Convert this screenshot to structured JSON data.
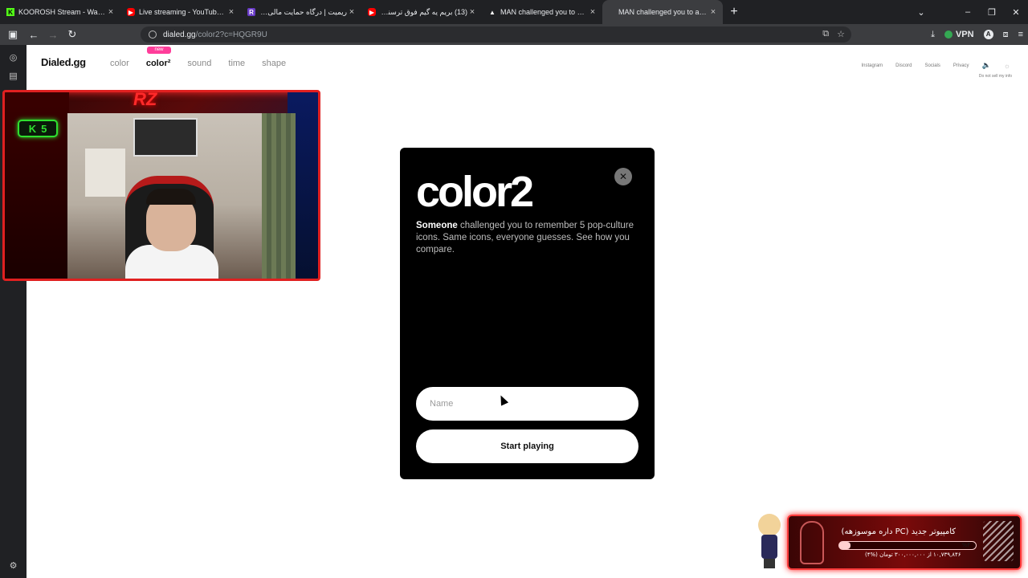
{
  "browser": {
    "tabs": [
      {
        "icon": "kick-icon",
        "title": "KOOROSH Stream - Watch Live",
        "active": false
      },
      {
        "icon": "youtube-icon",
        "title": "Live streaming - YouTube Studio",
        "active": false
      },
      {
        "icon": "reymit-icon",
        "title": "ریمیت | درگاه حمایت مالی از lad",
        "active": false
      },
      {
        "icon": "youtube-icon",
        "title": "(13) بریم یه گیم فوق ترسناک - e",
        "active": false
      },
      {
        "icon": "dialed-icon",
        "title": "MAN challenged you to a chara",
        "active": false
      },
      {
        "icon": "dialed-icon",
        "title": "MAN challenged you to a chara",
        "active": true
      }
    ],
    "url_host": "dialed.gg",
    "url_path": "/color2?c=HQGR9U",
    "vpn_label": "VPN",
    "profile_initial": "A"
  },
  "site": {
    "logo": "Dialed.gg",
    "nav": [
      {
        "label": "color",
        "active": false
      },
      {
        "label": "color²",
        "active": true
      },
      {
        "label": "sound",
        "active": false
      },
      {
        "label": "time",
        "active": false
      },
      {
        "label": "shape",
        "active": false
      }
    ],
    "new_badge": "new",
    "top_links": [
      "Instagram",
      "Discord",
      "Socials",
      "Privacy"
    ],
    "do_not_sell": "Do not sell my info"
  },
  "modal": {
    "title": "color2",
    "challenger": "Someone",
    "description": " challenged you to remember 5 pop-culture icons. Same icons, everyone guesses. See how you compare.",
    "name_placeholder": "Name",
    "start_label": "Start playing",
    "close_symbol": "✕"
  },
  "overlay": {
    "webcam_brand": "RZ",
    "kick_letter": "K",
    "kick_count": "5",
    "donation_title": "کامپیوتر جدید (PC داره موسوزهه)",
    "donation_percent_label": "%۴",
    "donation_progress": 0.04,
    "donation_amount": "۱۰,۷۳۹,۸۴۶ از ۳۰۰,۰۰۰,۰۰۰ تومان (%۴)"
  },
  "colors": {
    "modal_bg": "#000000",
    "new_badge": "#ff3d9a",
    "kick_green": "#2fe02f",
    "overlay_red": "#ff3a3a"
  }
}
